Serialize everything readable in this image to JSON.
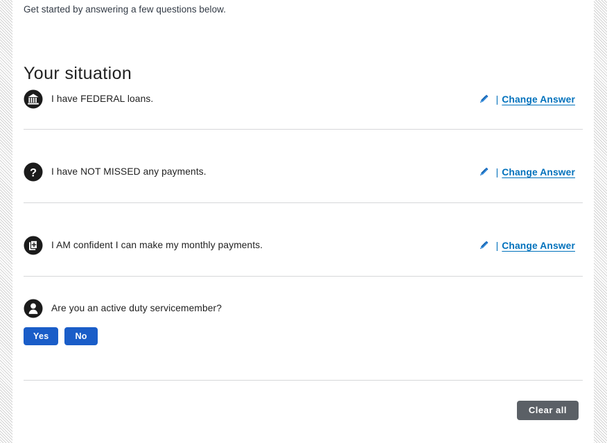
{
  "colors": {
    "link": "#0071bc",
    "primary_button": "#1a5dc8",
    "secondary_button": "#5b6066",
    "divider": "#d6d7d9",
    "icon_dark": "#1b1b1b",
    "text": "#212121"
  },
  "intro": {
    "text": "Get started by answering a few questions below."
  },
  "section": {
    "heading": "Your situation"
  },
  "rows": [
    {
      "icon": "bank-icon",
      "text": "I have FEDERAL loans.",
      "action": {
        "icon": "pencil-icon",
        "separator": "|",
        "label": "Change Answer"
      }
    },
    {
      "icon": "question-mark-icon",
      "text": "I have NOT MISSED any payments.",
      "action": {
        "icon": "pencil-icon",
        "separator": "|",
        "label": "Change Answer"
      }
    },
    {
      "icon": "document-plus-icon",
      "text": "I AM confident I can make my monthly payments.",
      "action": {
        "icon": "pencil-icon",
        "separator": "|",
        "label": "Change Answer"
      }
    },
    {
      "icon": "person-icon",
      "text": "Are you an active duty servicemember?",
      "action": null
    }
  ],
  "question_buttons": {
    "yes_label": "Yes",
    "no_label": "No"
  },
  "footer": {
    "clear_all_label": "Clear all"
  }
}
